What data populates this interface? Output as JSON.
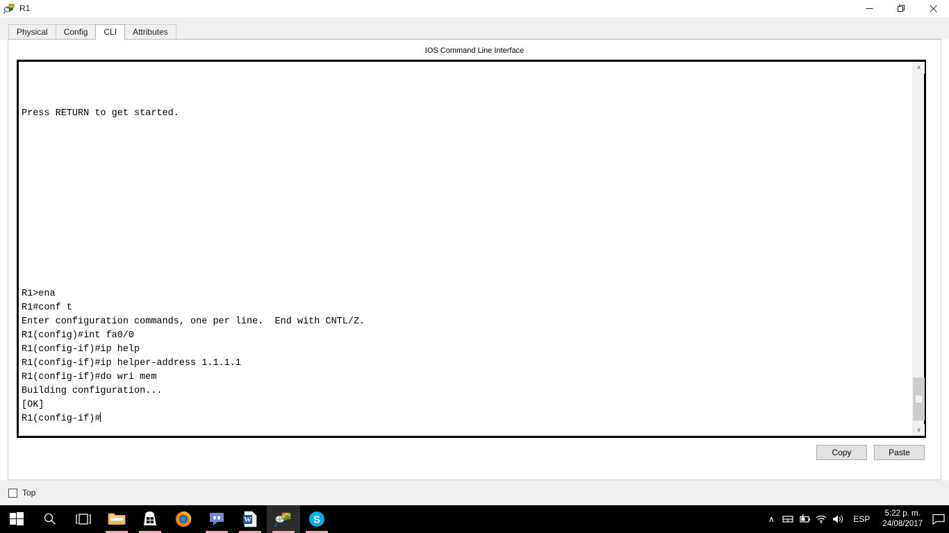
{
  "window": {
    "title": "R1",
    "icon": "router-icon",
    "controls": {
      "minimize": "—",
      "maximize": "❐",
      "close": "✕"
    }
  },
  "tabs": [
    {
      "label": "Physical",
      "active": false
    },
    {
      "label": "Config",
      "active": false
    },
    {
      "label": "CLI",
      "active": true
    },
    {
      "label": "Attributes",
      "active": false
    }
  ],
  "panel": {
    "heading": "IOS Command Line Interface"
  },
  "terminal": {
    "lines": [
      "",
      "",
      "",
      "Press RETURN to get started.",
      "",
      "",
      "",
      "",
      "",
      "",
      "",
      "",
      "",
      "",
      "",
      "",
      "R1>ena",
      "R1#conf t",
      "Enter configuration commands, one per line.  End with CNTL/Z.",
      "R1(config)#int fa0/0",
      "R1(config-if)#ip help",
      "R1(config-if)#ip helper-address 1.1.1.1",
      "R1(config-if)#do wri mem",
      "Building configuration...",
      "[OK]"
    ],
    "prompt": "R1(config-if)#",
    "scrollbar": {
      "up_arrow": "∧",
      "down_arrow": "∨"
    }
  },
  "buttons": {
    "copy": "Copy",
    "paste": "Paste"
  },
  "bottom": {
    "top_checkbox_label": "Top",
    "top_checkbox_checked": false
  },
  "taskbar": {
    "items": [
      {
        "name": "start-button",
        "running": false,
        "active": false
      },
      {
        "name": "search-icon",
        "running": false,
        "active": false
      },
      {
        "name": "task-view-icon",
        "running": false,
        "active": false
      },
      {
        "name": "file-explorer-icon",
        "running": true,
        "active": false
      },
      {
        "name": "microsoft-store-icon",
        "running": true,
        "active": false
      },
      {
        "name": "firefox-icon",
        "running": false,
        "active": false
      },
      {
        "name": "discord-icon",
        "running": true,
        "active": false
      },
      {
        "name": "word-icon",
        "running": true,
        "active": false
      },
      {
        "name": "packet-tracer-icon",
        "running": true,
        "active": true
      },
      {
        "name": "skype-icon",
        "running": true,
        "active": false
      }
    ],
    "tray": {
      "overflow": "∧",
      "icons": [
        "network-tray-icon",
        "battery-icon",
        "wifi-icon",
        "volume-icon"
      ],
      "language": "ESP",
      "time": "5:22 p. m.",
      "date": "24/08/2017",
      "action_center": "action-center-icon"
    }
  },
  "colors": {
    "window_bg": "#ffffff",
    "panel_bg": "#f0f0f0",
    "terminal_bg": "#ffffff",
    "terminal_fg": "#000000",
    "taskbar_bg": "#000000",
    "running_underline": "#f3a8b8",
    "scrollbar_thumb": "#cdcdcd"
  }
}
